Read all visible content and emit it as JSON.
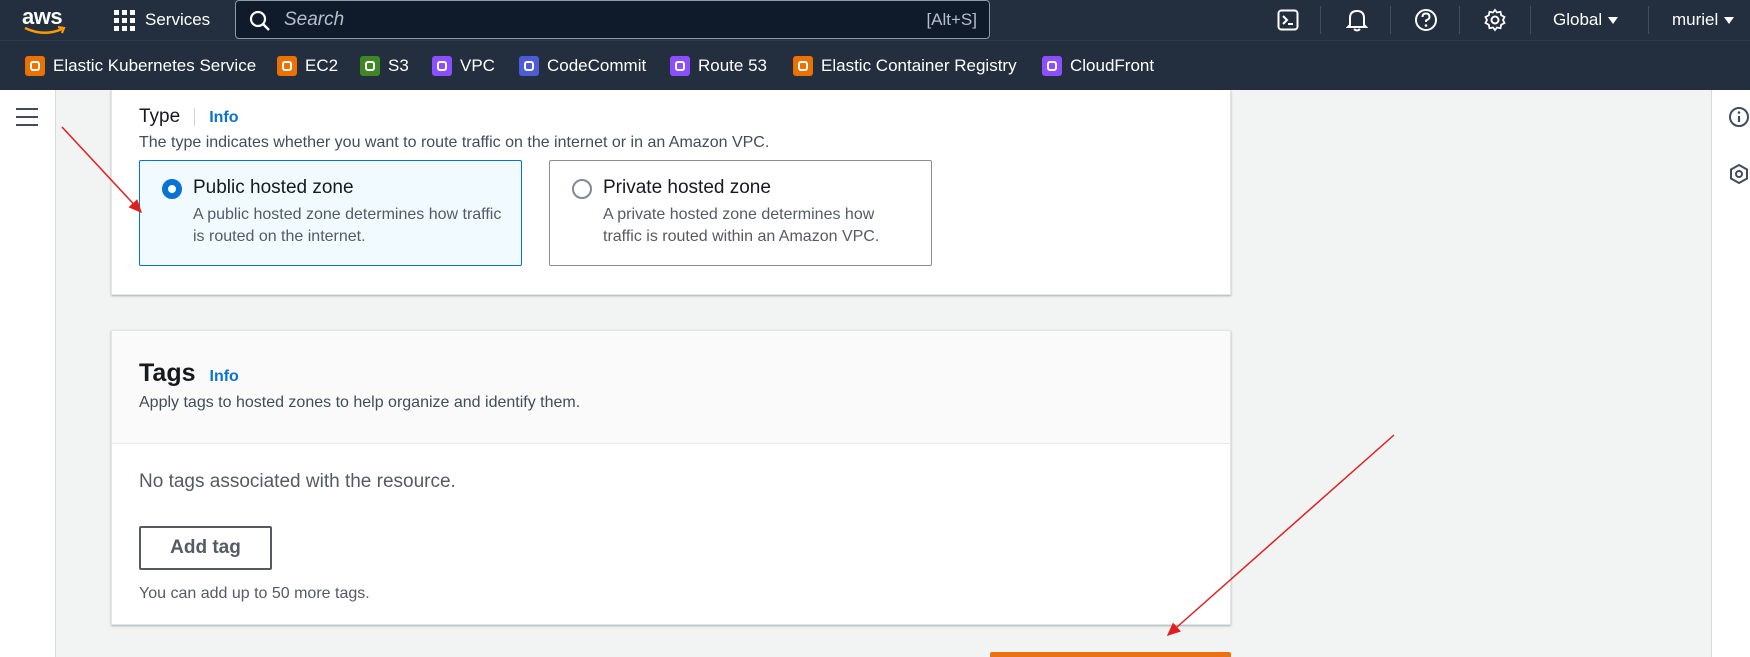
{
  "topnav": {
    "logo_text": "aws",
    "services_label": "Services",
    "search_placeholder": "Search",
    "search_shortcut": "[Alt+S]",
    "region_label": "Global",
    "user_label": "muriel"
  },
  "favorites": [
    {
      "label": "Elastic Kubernetes Service",
      "color": "#ed7100"
    },
    {
      "label": "EC2",
      "color": "#ed7100"
    },
    {
      "label": "S3",
      "color": "#3f8624"
    },
    {
      "label": "VPC",
      "color": "#8c4fff"
    },
    {
      "label": "CodeCommit",
      "color": "#4d5bd9"
    },
    {
      "label": "Route 53",
      "color": "#8c4fff"
    },
    {
      "label": "Elastic Container Registry",
      "color": "#ed7100"
    },
    {
      "label": "CloudFront",
      "color": "#8c4fff"
    }
  ],
  "type_section": {
    "label": "Type",
    "info": "Info",
    "description": "The type indicates whether you want to route traffic on the internet or in an Amazon VPC.",
    "options": [
      {
        "title": "Public hosted zone",
        "description": "A public hosted zone determines how traffic is routed on the internet.",
        "selected": true
      },
      {
        "title": "Private hosted zone",
        "description": "A private hosted zone determines how traffic is routed within an Amazon VPC.",
        "selected": false
      }
    ]
  },
  "tags_section": {
    "title": "Tags",
    "info": "Info",
    "description": "Apply tags to hosted zones to help organize and identify them.",
    "empty_message": "No tags associated with the resource.",
    "add_button": "Add tag",
    "limit_text": "You can add up to 50 more tags."
  },
  "colors": {
    "nav_bg": "#232f3e",
    "link_blue": "#0972d3",
    "primary_orange": "#ec7211",
    "annotation_red": "#e02020"
  }
}
